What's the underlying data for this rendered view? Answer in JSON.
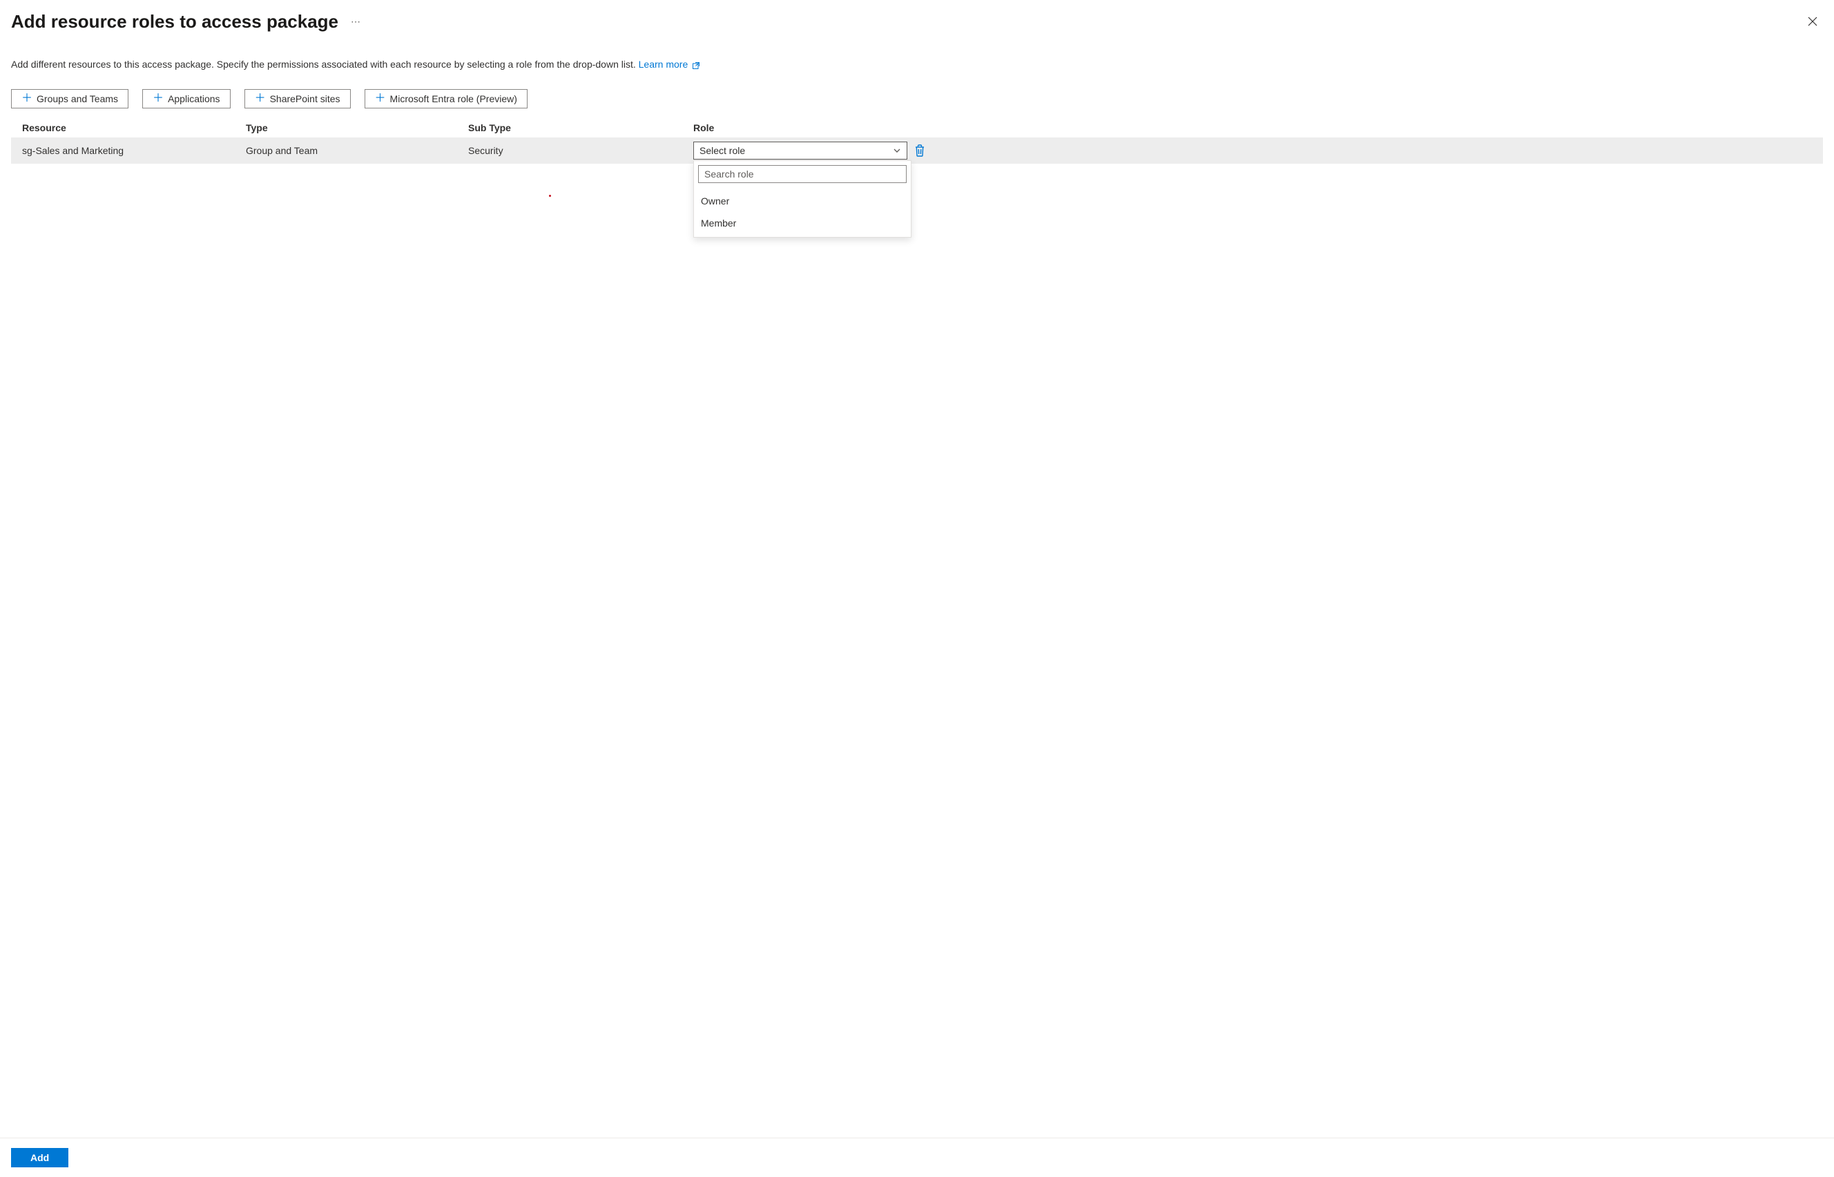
{
  "header": {
    "title": "Add resource roles to access package"
  },
  "description": {
    "text": "Add different resources to this access package. Specify the permissions associated with each resource by selecting a role from the drop-down list. ",
    "learn_more": "Learn more"
  },
  "add_buttons": {
    "groups": "Groups and Teams",
    "applications": "Applications",
    "sharepoint": "SharePoint sites",
    "entra_role": "Microsoft Entra role (Preview)"
  },
  "table": {
    "headers": {
      "resource": "Resource",
      "type": "Type",
      "subtype": "Sub Type",
      "role": "Role"
    },
    "rows": [
      {
        "resource": "sg-Sales and Marketing",
        "type": "Group and Team",
        "subtype": "Security",
        "role_placeholder": "Select role"
      }
    ]
  },
  "role_dropdown": {
    "search_placeholder": "Search role",
    "options": [
      "Owner",
      "Member"
    ]
  },
  "footer": {
    "add": "Add"
  }
}
